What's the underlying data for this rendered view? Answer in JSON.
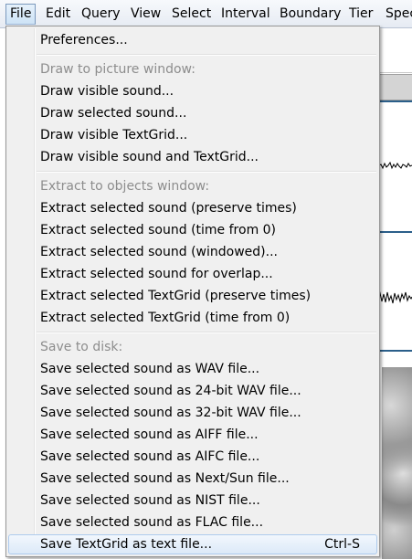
{
  "menubar": {
    "items": [
      "File",
      "Edit",
      "Query",
      "View",
      "Select",
      "Interval",
      "Boundary",
      "Tier",
      "Spec"
    ]
  },
  "file_menu": {
    "preferences": "Preferences...",
    "draw_header": "Draw to picture window:",
    "draw_items": [
      "Draw visible sound...",
      "Draw selected sound...",
      "Draw visible TextGrid...",
      "Draw visible sound and TextGrid..."
    ],
    "extract_header": "Extract to objects window:",
    "extract_items": [
      "Extract selected sound (preserve times)",
      "Extract selected sound (time from 0)",
      "Extract selected sound (windowed)...",
      "Extract selected sound for overlap...",
      "Extract selected TextGrid (preserve times)",
      "Extract selected TextGrid (time from 0)"
    ],
    "save_header": "Save to disk:",
    "save_items": [
      "Save selected sound as WAV file...",
      "Save selected sound as 24-bit WAV file...",
      "Save selected sound as 32-bit WAV file...",
      "Save selected sound as AIFF file...",
      "Save selected sound as AIFC file...",
      "Save selected sound as Next/Sun file...",
      "Save selected sound as NIST file...",
      "Save selected sound as FLAC file..."
    ],
    "save_textgrid": "Save TextGrid as text file...",
    "save_textgrid_shortcut": "Ctrl-S"
  },
  "colors": {
    "menu_bg": "#f0f0f0",
    "header_text": "#8d8d8d",
    "highlight_border": "#aecbed",
    "accent_line": "#2b5f8a"
  }
}
